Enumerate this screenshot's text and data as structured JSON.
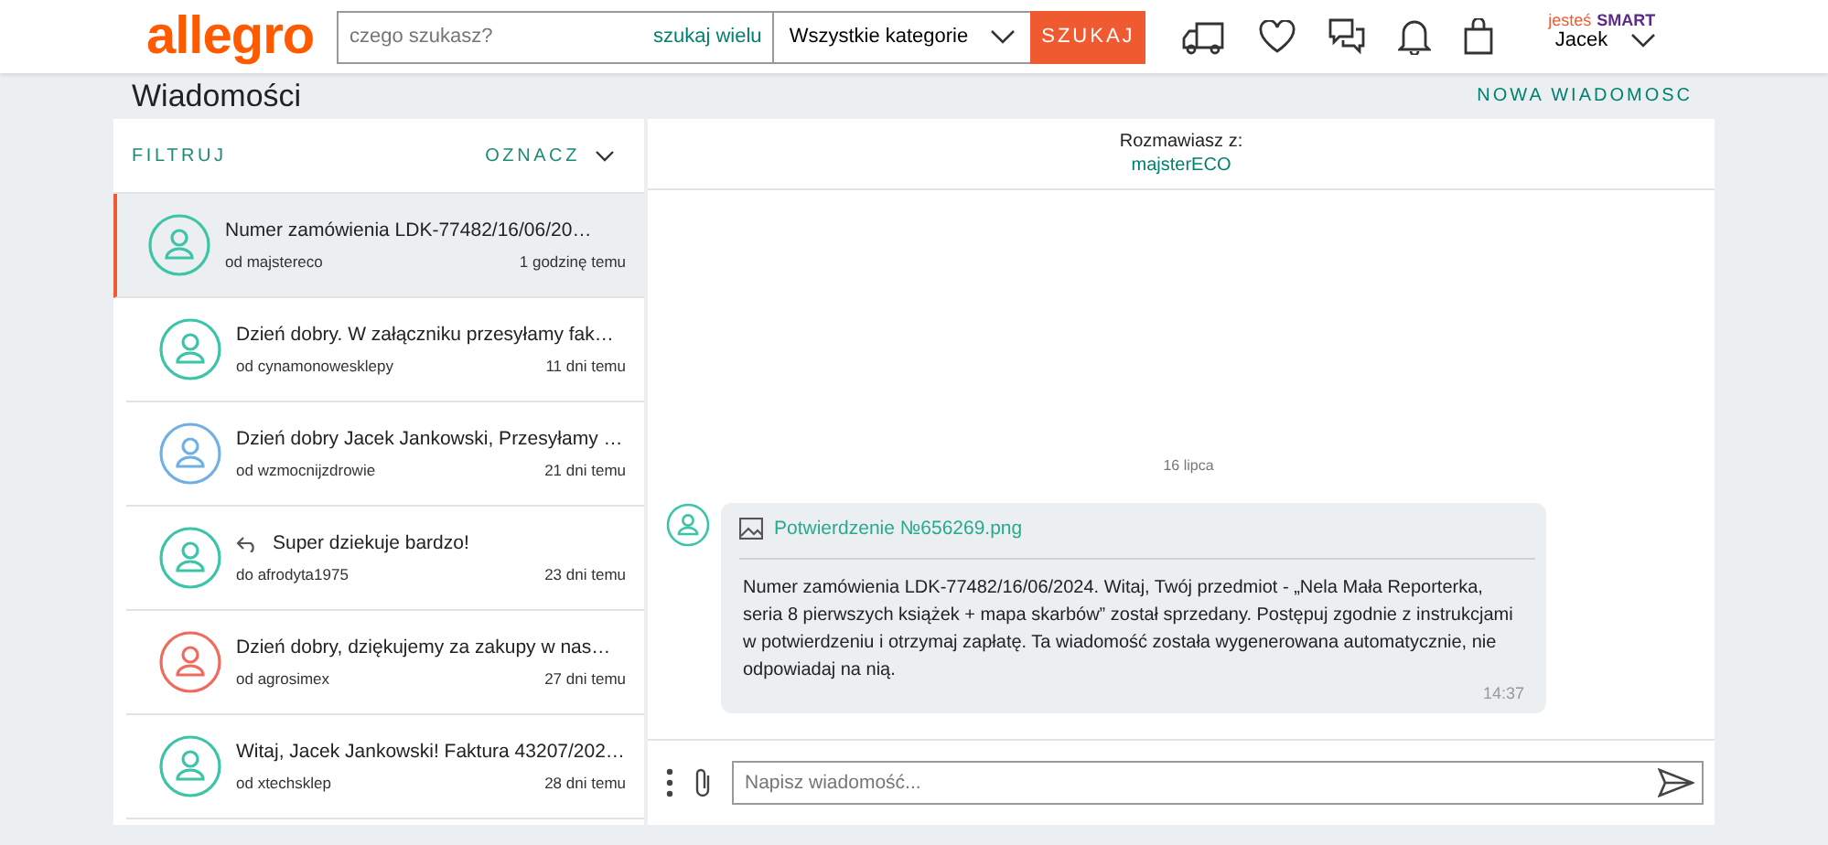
{
  "header": {
    "logo": "allegro",
    "search": {
      "placeholder": "czego szukasz?"
    },
    "search_many": "szukaj wielu",
    "category": "Wszystkie kategorie",
    "search_button": "SZUKAJ",
    "smart_prefix": "jesteś",
    "smart_label": "SMART",
    "user": "Jacek"
  },
  "page": {
    "title": "Wiadomości",
    "new_message": "NOWA WIADOMOSC"
  },
  "list": {
    "filter": "FILTRUJ",
    "mark": "OZNACZ",
    "items": [
      {
        "subject": "Numer zamówienia LDK-77482/16/06/20…",
        "sender": "od majstereco",
        "time": "1 godzinę temu",
        "selected": true,
        "replied": false,
        "color": "#3cc4a8"
      },
      {
        "subject": "Dzień dobry. W załączniku przesyłamy fak…",
        "sender": "od cynamonowesklepy",
        "time": "11 dni temu",
        "selected": false,
        "replied": false,
        "color": "#3cc4a8"
      },
      {
        "subject": "Dzień dobry Jacek Jankowski, Przesyłamy …",
        "sender": "od wzmocnijzdrowie",
        "time": "21 dni temu",
        "selected": false,
        "replied": false,
        "color": "#6fb0e6"
      },
      {
        "subject": "Super dziekuje bardzo!",
        "sender": "do afrodyta1975",
        "time": "23 dni temu",
        "selected": false,
        "replied": true,
        "color": "#3cc4a8"
      },
      {
        "subject": "Dzień dobry, dziękujemy za zakupy w nas…",
        "sender": "od agrosimex",
        "time": "27 dni temu",
        "selected": false,
        "replied": false,
        "color": "#f06b5e"
      },
      {
        "subject": "Witaj, Jacek Jankowski! Faktura 43207/202…",
        "sender": "od xtechsklep",
        "time": "28 dni temu",
        "selected": false,
        "replied": false,
        "color": "#3cc4a8"
      }
    ]
  },
  "conversation": {
    "label": "Rozmawiasz z:",
    "partner": "majsterECO",
    "date": "16 lipca",
    "message": {
      "attachment": "Potwierdzenie №656269.png",
      "text": "Numer zamówienia LDK-77482/16/06/2024. Witaj, Twój przedmiot - „Nela Mała Reporterka, seria 8 pierwszych książek + mapa skarbów” został sprzedany. Postępuj zgodnie z instrukcjami w potwierdzeniu i otrzymaj zapłatę. Ta wiadomość została wygenerowana automatycznie, nie odpowiadaj na nią.",
      "time": "14:37"
    },
    "input": {
      "placeholder": "Napisz wiadomość..."
    }
  }
}
